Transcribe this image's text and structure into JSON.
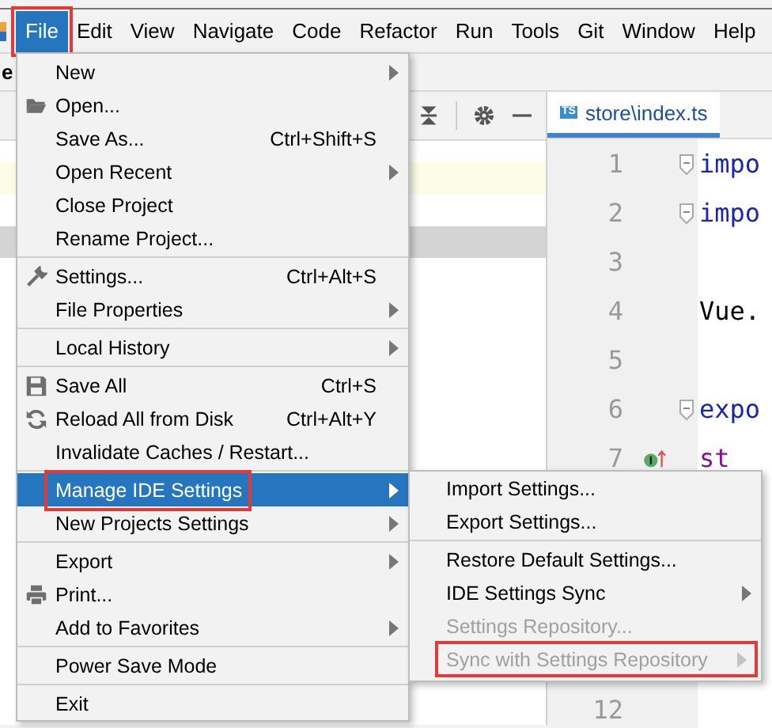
{
  "menu_bar": [
    {
      "label": "File",
      "selected": true,
      "outlined": true
    },
    {
      "label": "Edit",
      "selected": false,
      "outlined": false
    },
    {
      "label": "View",
      "selected": false,
      "outlined": false
    },
    {
      "label": "Navigate",
      "selected": false,
      "outlined": false
    },
    {
      "label": "Code",
      "selected": false,
      "outlined": false
    },
    {
      "label": "Refactor",
      "selected": false,
      "outlined": false
    },
    {
      "label": "Run",
      "selected": false,
      "outlined": false
    },
    {
      "label": "Tools",
      "selected": false,
      "outlined": false
    },
    {
      "label": "Git",
      "selected": false,
      "outlined": false
    },
    {
      "label": "Window",
      "selected": false,
      "outlined": false
    },
    {
      "label": "Help",
      "selected": false,
      "outlined": false
    }
  ],
  "project_panel": {
    "title": "e"
  },
  "editor": {
    "tab": {
      "label": "store\\index.ts",
      "badge": "TS"
    },
    "lines": [
      {
        "number": "1",
        "code": "impo",
        "kind": "keyword",
        "fold": true,
        "marker": false
      },
      {
        "number": "2",
        "code": "impo",
        "kind": "keyword",
        "fold": true,
        "marker": false
      },
      {
        "number": "3",
        "fold": false,
        "marker": false
      },
      {
        "number": "4",
        "code": "Vue.",
        "kind": "plain",
        "fold": false,
        "marker": false
      },
      {
        "number": "5",
        "fold": false,
        "marker": false
      },
      {
        "number": "6",
        "code": "expo",
        "kind": "keyword",
        "fold": true,
        "marker": false
      },
      {
        "number": "7",
        "code": "st",
        "kind": "property",
        "fold": false,
        "marker": true
      }
    ],
    "lower_lines": [
      {
        "number": "12"
      }
    ]
  },
  "file_menu": [
    {
      "kind": "item",
      "label": "New",
      "submenu": true,
      "disabled": false,
      "selected": false,
      "outlined": false
    },
    {
      "kind": "item",
      "label": "Open...",
      "submenu": false,
      "disabled": false,
      "selected": false,
      "outlined": false
    },
    {
      "kind": "item",
      "label": "Save As...",
      "shortcut": "Ctrl+Shift+S",
      "submenu": false,
      "disabled": false,
      "selected": false,
      "outlined": false
    },
    {
      "kind": "item",
      "label": "Open Recent",
      "submenu": true,
      "disabled": false,
      "selected": false,
      "outlined": false
    },
    {
      "kind": "item",
      "label": "Close Project",
      "submenu": false,
      "disabled": false,
      "selected": false,
      "outlined": false
    },
    {
      "kind": "item",
      "label": "Rename Project...",
      "submenu": false,
      "disabled": false,
      "selected": false,
      "outlined": false
    },
    {
      "kind": "separator"
    },
    {
      "kind": "item",
      "label": "Settings...",
      "shortcut": "Ctrl+Alt+S",
      "submenu": false,
      "disabled": false,
      "selected": false,
      "outlined": false
    },
    {
      "kind": "item",
      "label": "File Properties",
      "submenu": true,
      "disabled": false,
      "selected": false,
      "outlined": false
    },
    {
      "kind": "separator"
    },
    {
      "kind": "item",
      "label": "Local History",
      "submenu": true,
      "disabled": false,
      "selected": false,
      "outlined": false
    },
    {
      "kind": "separator"
    },
    {
      "kind": "item",
      "label": "Save All",
      "shortcut": "Ctrl+S",
      "submenu": false,
      "disabled": false,
      "selected": false,
      "outlined": false
    },
    {
      "kind": "item",
      "label": "Reload All from Disk",
      "shortcut": "Ctrl+Alt+Y",
      "submenu": false,
      "disabled": false,
      "selected": false,
      "outlined": false
    },
    {
      "kind": "item",
      "label": "Invalidate Caches / Restart...",
      "submenu": false,
      "disabled": false,
      "selected": false,
      "outlined": false
    },
    {
      "kind": "separator"
    },
    {
      "kind": "item",
      "label": "Manage IDE Settings",
      "submenu": true,
      "disabled": false,
      "selected": true,
      "outlined": true
    },
    {
      "kind": "item",
      "label": "New Projects Settings",
      "submenu": true,
      "disabled": false,
      "selected": false,
      "outlined": false
    },
    {
      "kind": "separator"
    },
    {
      "kind": "item",
      "label": "Export",
      "submenu": true,
      "disabled": false,
      "selected": false,
      "outlined": false
    },
    {
      "kind": "item",
      "label": "Print...",
      "submenu": false,
      "disabled": false,
      "selected": false,
      "outlined": false
    },
    {
      "kind": "item",
      "label": "Add to Favorites",
      "submenu": true,
      "disabled": false,
      "selected": false,
      "outlined": false
    },
    {
      "kind": "separator"
    },
    {
      "kind": "item",
      "label": "Power Save Mode",
      "submenu": false,
      "disabled": false,
      "selected": false,
      "outlined": false
    },
    {
      "kind": "separator"
    },
    {
      "kind": "item",
      "label": "Exit",
      "submenu": false,
      "disabled": false,
      "selected": false,
      "outlined": false
    }
  ],
  "settings_submenu": [
    {
      "kind": "item",
      "label": "Import Settings...",
      "submenu": false,
      "disabled": false,
      "outlined": false
    },
    {
      "kind": "item",
      "label": "Export Settings...",
      "submenu": false,
      "disabled": false,
      "outlined": false
    },
    {
      "kind": "separator"
    },
    {
      "kind": "item",
      "label": "Restore Default Settings...",
      "submenu": false,
      "disabled": false,
      "outlined": false
    },
    {
      "kind": "item",
      "label": "IDE Settings Sync",
      "submenu": true,
      "disabled": false,
      "outlined": false
    },
    {
      "kind": "item",
      "label": "Settings Repository...",
      "submenu": false,
      "disabled": true,
      "outlined": false
    },
    {
      "kind": "item",
      "label": "Sync with Settings Repository",
      "submenu": true,
      "disabled": true,
      "outlined": true
    }
  ]
}
